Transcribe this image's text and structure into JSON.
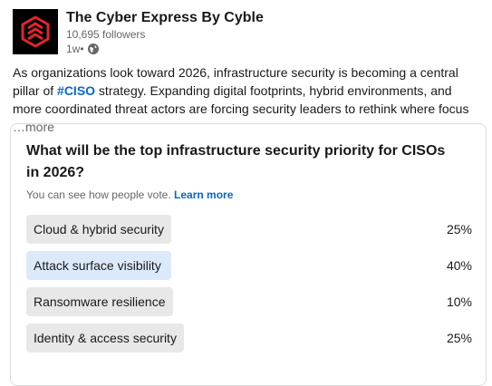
{
  "post": {
    "author": "The Cyber Express By Cyble",
    "followers": "10,695 followers",
    "time": "1w",
    "time_separator": "•",
    "text_before_hashtag": "As organizations look toward 2026, infrastructure security is becoming a central pillar of ",
    "hashtag": "#CISO",
    "text_after_hashtag": " strategy. Expanding digital footprints, hybrid environments, and more coordinated threat actors are forcing security leaders to rethink where focus",
    "more_label": "…more"
  },
  "poll": {
    "question": "What will be the top infrastructure security priority for CISOs in 2026?",
    "visibility_text": "You can see how people vote.",
    "learn_more": "Learn more",
    "options": [
      {
        "label": "Cloud & hybrid security",
        "percent": "25%",
        "fraction": 0.25,
        "selected": false
      },
      {
        "label": "Attack surface visibility",
        "percent": "40%",
        "fraction": 0.4,
        "selected": true
      },
      {
        "label": "Ransomware resilience",
        "percent": "10%",
        "fraction": 0.1,
        "selected": false
      },
      {
        "label": "Identity & access security",
        "percent": "25%",
        "fraction": 0.25,
        "selected": false
      }
    ]
  },
  "colors": {
    "link": "#0a66c2",
    "bar": "#e8e8e8",
    "bar_selected": "#dbeafb",
    "logo_bg": "#000000",
    "logo_mark": "#e4252b"
  },
  "icons": {
    "logo": "cyble-logo-icon",
    "visibility": "globe-icon"
  }
}
